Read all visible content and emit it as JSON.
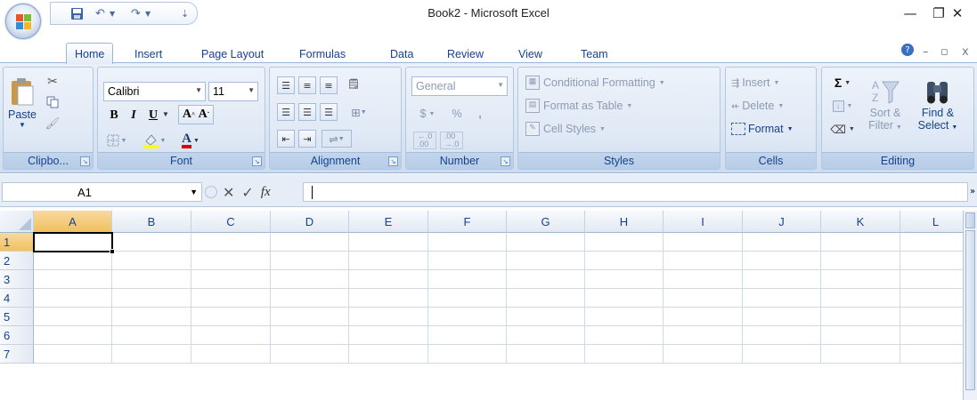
{
  "window": {
    "title": "Book2 - Microsoft Excel",
    "minimize_glyph": "—",
    "restore_glyph": "❐",
    "close_glyph": "✕"
  },
  "quick_access": {
    "save_icon": "save-icon",
    "undo_icon": "undo-icon",
    "redo_icon": "redo-icon",
    "customize_icon": "customize-qat-icon"
  },
  "tabs": [
    "Home",
    "Insert",
    "Page Layout",
    "Formulas",
    "Data",
    "Review",
    "View",
    "Team"
  ],
  "active_tab": "Home",
  "ribbon": {
    "clipboard": {
      "label": "Clipbo...",
      "paste": "Paste"
    },
    "font": {
      "label": "Font",
      "font_name": "Calibri",
      "font_size": "11",
      "bold": "B",
      "italic": "I",
      "underline": "U"
    },
    "alignment": {
      "label": "Alignment"
    },
    "number": {
      "label": "Number",
      "format": "General",
      "currency": "$",
      "percent": "%",
      "comma": ","
    },
    "styles": {
      "label": "Styles",
      "conditional": "Conditional Formatting",
      "format_table": "Format as Table",
      "cell_styles": "Cell Styles"
    },
    "cells": {
      "label": "Cells",
      "insert": "Insert",
      "delete": "Delete",
      "format": "Format"
    },
    "editing": {
      "label": "Editing",
      "sort_filter_1": "Sort &",
      "sort_filter_2": "Filter",
      "find_select_1": "Find &",
      "find_select_2": "Select"
    }
  },
  "formula_bar": {
    "name_box": "A1",
    "fx": "fx",
    "value": ""
  },
  "sheet": {
    "columns": [
      "A",
      "B",
      "C",
      "D",
      "E",
      "F",
      "G",
      "H",
      "I",
      "J",
      "K",
      "L"
    ],
    "rows": [
      "1",
      "2",
      "3",
      "4",
      "5",
      "6",
      "7"
    ],
    "active_cell": "A1"
  },
  "colors": {
    "accent": "#15428b",
    "ribbon_bg": "#dbe6f4",
    "selected_header": "#f1c15f",
    "grid_line": "#d0d7e5"
  }
}
